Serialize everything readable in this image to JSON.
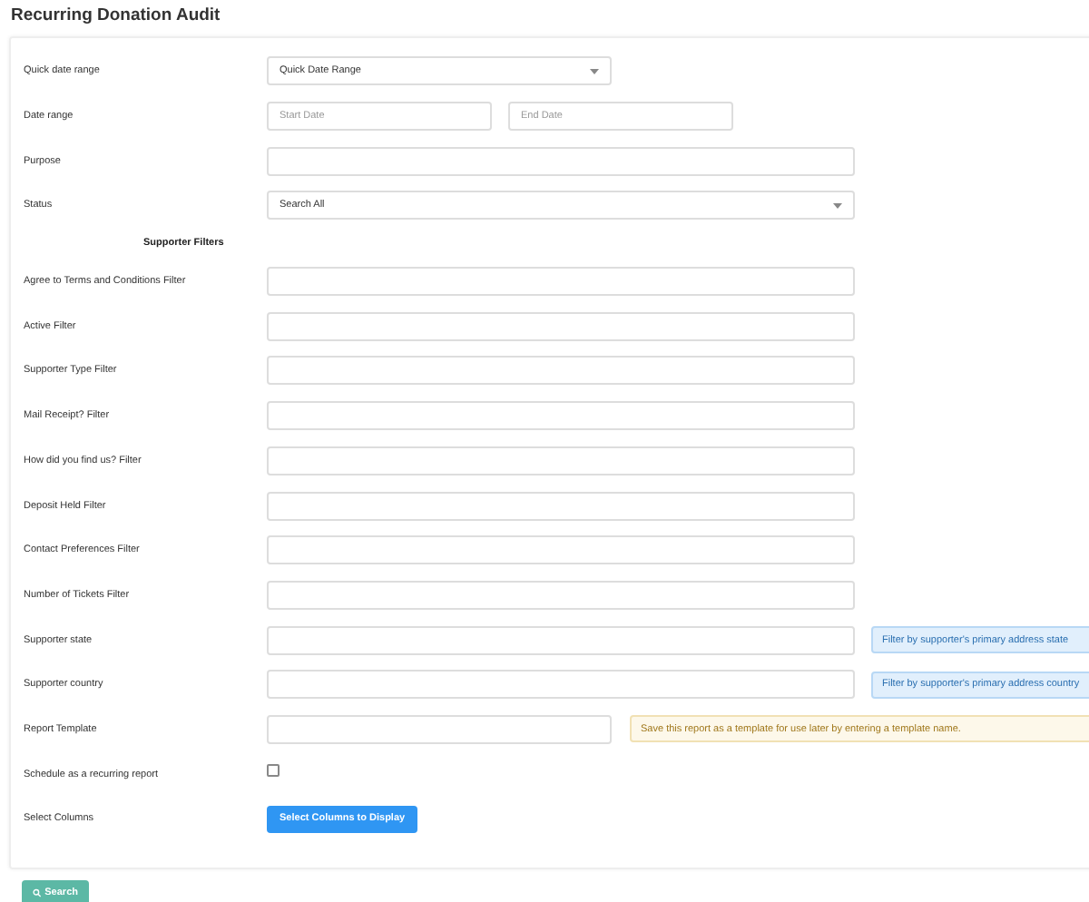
{
  "page_title": "Recurring Donation Audit",
  "rows": [
    {
      "kind": "select",
      "label": "Quick date range",
      "value": "Quick Date Range"
    },
    {
      "kind": "daterange",
      "label": "Date range",
      "start_placeholder": "Start Date",
      "end_placeholder": "End Date"
    },
    {
      "kind": "text",
      "label": "Purpose"
    },
    {
      "kind": "wideselect",
      "label": "Status",
      "value": "Search All"
    },
    {
      "kind": "heading",
      "label": "Supporter Filters"
    },
    {
      "kind": "text",
      "label": "Agree to Terms and Conditions Filter"
    },
    {
      "kind": "text",
      "label": "Active Filter"
    },
    {
      "kind": "text",
      "label": "Supporter Type Filter"
    },
    {
      "kind": "text",
      "label": "Mail Receipt? Filter"
    },
    {
      "kind": "text",
      "label": "How did you find us? Filter"
    },
    {
      "kind": "text",
      "label": "Deposit Held Filter"
    },
    {
      "kind": "text",
      "label": "Contact Preferences Filter"
    },
    {
      "kind": "text",
      "label": "Number of Tickets Filter"
    },
    {
      "kind": "text",
      "label": "Supporter state",
      "hint": {
        "kind": "info",
        "text": "Filter by supporter's primary address state"
      }
    },
    {
      "kind": "text",
      "label": "Supporter country",
      "hint": {
        "kind": "info",
        "text": "Filter by supporter's primary address country"
      }
    },
    {
      "kind": "shorttext",
      "label": "Report Template",
      "hint": {
        "kind": "warning",
        "text": "Save this report as a template for use later by entering a template name."
      }
    },
    {
      "kind": "checkbox",
      "label": "Schedule as a recurring report",
      "checked": false
    },
    {
      "kind": "button",
      "label": "Select Columns",
      "button": "Select Columns to Display"
    }
  ],
  "search_button": "Search"
}
